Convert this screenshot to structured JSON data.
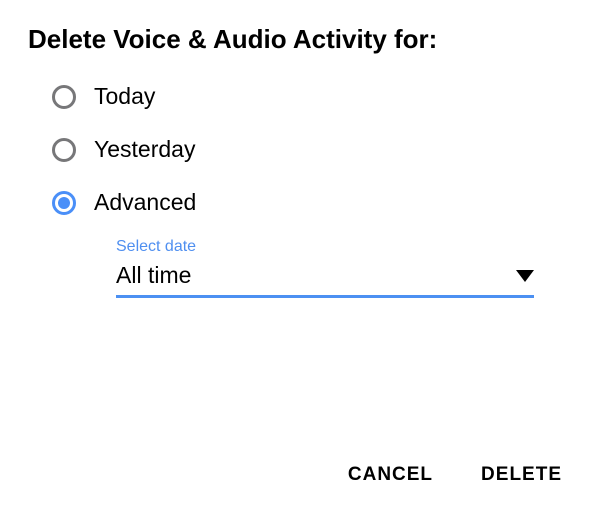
{
  "dialog": {
    "title": "Delete Voice & Audio Activity for:",
    "options": [
      {
        "label": "Today",
        "selected": false
      },
      {
        "label": "Yesterday",
        "selected": false
      },
      {
        "label": "Advanced",
        "selected": true
      }
    ],
    "select": {
      "caption": "Select date",
      "value": "All time"
    },
    "actions": {
      "cancel": "CANCEL",
      "delete": "DELETE"
    }
  },
  "colors": {
    "accent": "#4A8FF8",
    "unselected_ring": "#777779"
  }
}
